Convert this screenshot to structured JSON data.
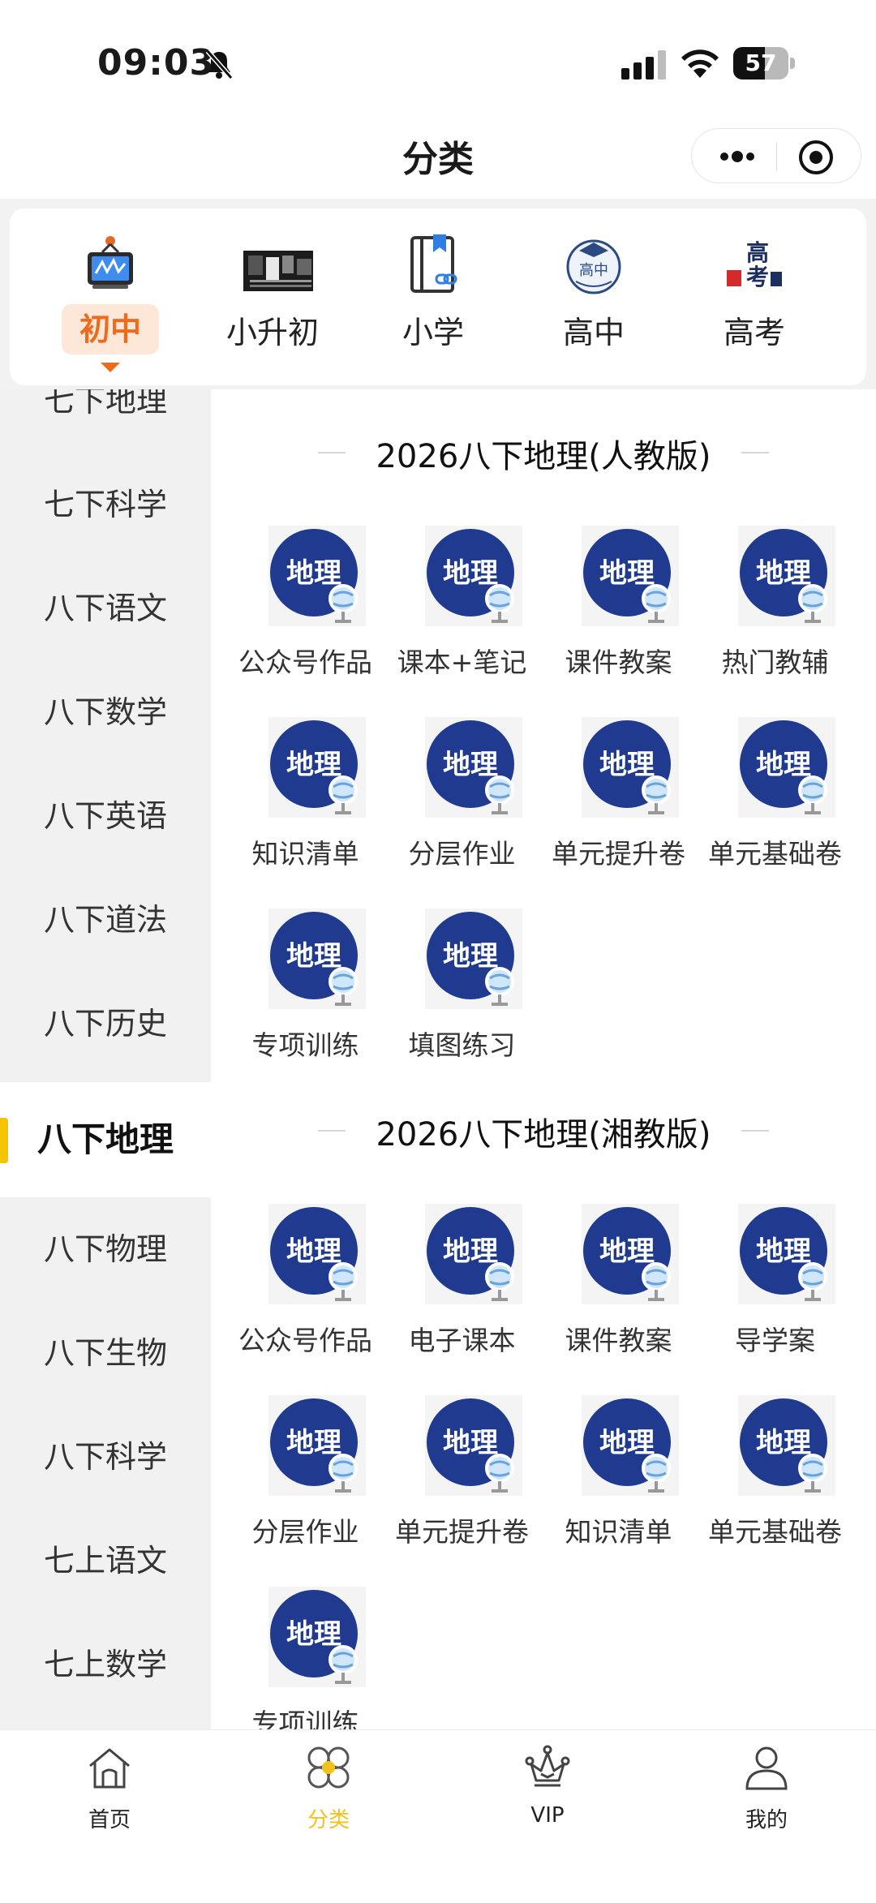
{
  "status": {
    "time": "09:03",
    "battery": "57",
    "battery_level": 0.57
  },
  "nav": {
    "title": "分类"
  },
  "grades": [
    {
      "label": "初中",
      "icon": "monitor-icon",
      "active": true
    },
    {
      "label": "小升初",
      "icon": "banner-image-icon",
      "active": false
    },
    {
      "label": "小学",
      "icon": "bookmark-link-icon",
      "active": false
    },
    {
      "label": "高中",
      "icon": "graduation-cap-icon",
      "active": false
    },
    {
      "label": "高考",
      "icon": "gaokao-icon",
      "active": false
    }
  ],
  "sidebar": {
    "items": [
      "七下地理",
      "七下科学",
      "八下语文",
      "八下数学",
      "八下英语",
      "八下道法",
      "八下历史",
      "八下地理",
      "八下物理",
      "八下生物",
      "八下科学",
      "七上语文",
      "七上数学"
    ],
    "active_index": 7
  },
  "sections": [
    {
      "title": "2026八下地理(人教版)",
      "items": [
        "公众号作品",
        "课本+笔记",
        "课件教案",
        "热门教辅",
        "知识清单",
        "分层作业",
        "单元提升卷",
        "单元基础卷",
        "专项训练",
        "填图练习"
      ]
    },
    {
      "title": "2026八下地理(湘教版)",
      "items": [
        "公众号作品",
        "电子课本",
        "课件教案",
        "导学案",
        "分层作业",
        "单元提升卷",
        "知识清单",
        "单元基础卷",
        "专项训练"
      ]
    }
  ],
  "tile_icon_text": "地理",
  "tabbar": {
    "items": [
      {
        "label": "首页",
        "icon": "home-icon"
      },
      {
        "label": "分类",
        "icon": "category-icon"
      },
      {
        "label": "VIP",
        "icon": "crown-icon"
      },
      {
        "label": "我的",
        "icon": "user-icon"
      }
    ],
    "active_index": 1
  },
  "colors": {
    "accent_orange": "#ef6b1c",
    "accent_yellow": "#f2c21b",
    "tile_blue": "#1f3a8f"
  }
}
